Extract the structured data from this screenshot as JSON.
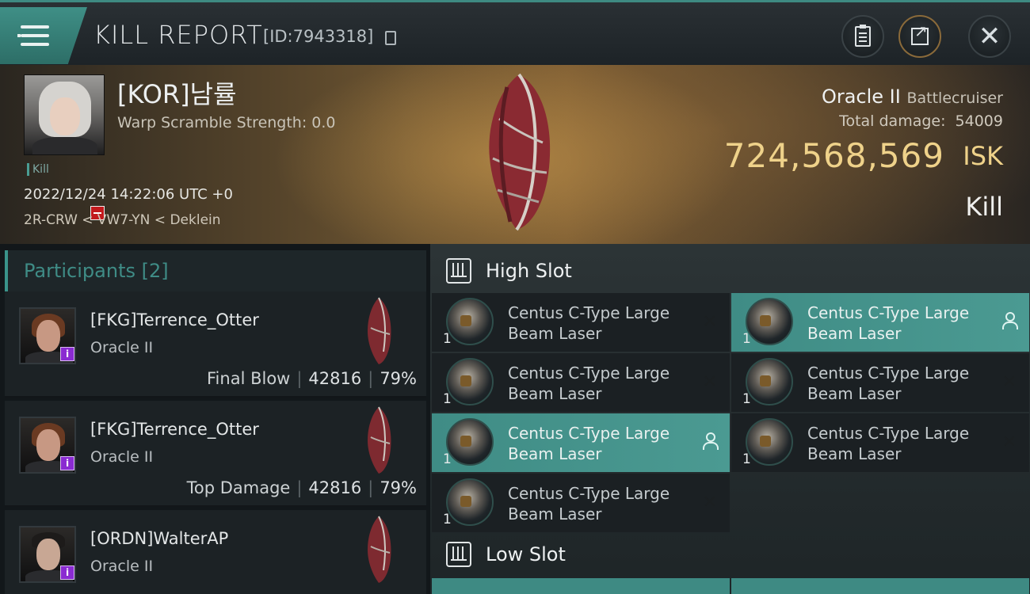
{
  "header": {
    "title": "KILL REPORT",
    "report_id": "[ID:7943318]",
    "icons": {
      "menu": "menu-icon",
      "copy": "copy-icon",
      "clipboard": "clipboard-icon",
      "share": "share-icon",
      "close": "close-icon"
    }
  },
  "victim": {
    "name": "[KOR]남률",
    "warp_scramble": "Warp Scramble Strength: 0.0",
    "tag": "Kill",
    "datetime": "2022/12/24 14:22:06 UTC +0",
    "location": "2R-CRW < VW7-YN < Deklein",
    "ship_name": "Oracle II",
    "ship_class": "Battlecruiser",
    "total_damage_label": "Total damage:",
    "total_damage_value": "54009",
    "isk_value": "724,568,569",
    "isk_unit": "ISK",
    "result": "Kill"
  },
  "participants": {
    "label": "Participants [2]",
    "rows": [
      {
        "name": "[FKG]Terrence_Otter",
        "ship": "Oracle II",
        "stat_label": "Final Blow",
        "damage": "42816",
        "percent": "79%"
      },
      {
        "name": "[FKG]Terrence_Otter",
        "ship": "Oracle II",
        "stat_label": "Top Damage",
        "damage": "42816",
        "percent": "79%"
      },
      {
        "name": "[ORDN]WalterAP",
        "ship": "Oracle II"
      }
    ]
  },
  "fitting": {
    "high_slot_label": "High Slot",
    "low_slot_label": "Low Slot",
    "high_modules": [
      {
        "name": "Centus C-Type Large Beam Laser",
        "qty": "1",
        "state": "destroyed"
      },
      {
        "name": "Centus C-Type Large Beam Laser",
        "qty": "1",
        "state": "dropped"
      },
      {
        "name": "Centus C-Type Large Beam Laser",
        "qty": "1",
        "state": "destroyed"
      },
      {
        "name": "Centus C-Type Large Beam Laser",
        "qty": "1",
        "state": "destroyed"
      },
      {
        "name": "Centus C-Type Large Beam Laser",
        "qty": "1",
        "state": "dropped"
      },
      {
        "name": "Centus C-Type Large Beam Laser",
        "qty": "1",
        "state": "destroyed"
      },
      {
        "name": "Centus C-Type Large Beam Laser",
        "qty": "1",
        "state": "destroyed"
      }
    ],
    "destroyed_glyph": "✕"
  },
  "colors": {
    "accent": "#3f8c85",
    "isk_gold": "#efd28a",
    "corp_badge": "#c2191c",
    "role_badge": "#8a2bd1"
  }
}
